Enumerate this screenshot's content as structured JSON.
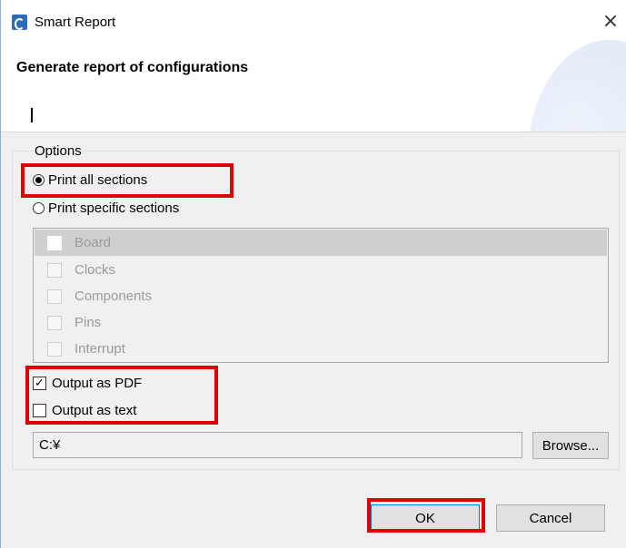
{
  "window": {
    "title": "Smart Report",
    "close_label": "×"
  },
  "banner": {
    "title": "Generate report of configurations"
  },
  "options": {
    "legend": "Options",
    "print_all_label": "Print all sections",
    "print_all_selected": true,
    "print_specific_label": "Print specific sections",
    "sections": [
      {
        "label": "Board",
        "checked": false,
        "enabled": false
      },
      {
        "label": "Clocks",
        "checked": false,
        "enabled": false
      },
      {
        "label": "Components",
        "checked": false,
        "enabled": false
      },
      {
        "label": "Pins",
        "checked": false,
        "enabled": false
      },
      {
        "label": "Interrupt",
        "checked": false,
        "enabled": false
      }
    ],
    "output_pdf_label": "Output as PDF",
    "output_pdf_checked": true,
    "output_text_label": "Output as text",
    "output_text_checked": false,
    "path_value": "C:¥",
    "browse_label": "Browse..."
  },
  "footer": {
    "ok_label": "OK",
    "cancel_label": "Cancel"
  },
  "colors": {
    "highlight": "#e00000",
    "accent": "#0078d7",
    "icon": "#2e6db4"
  }
}
